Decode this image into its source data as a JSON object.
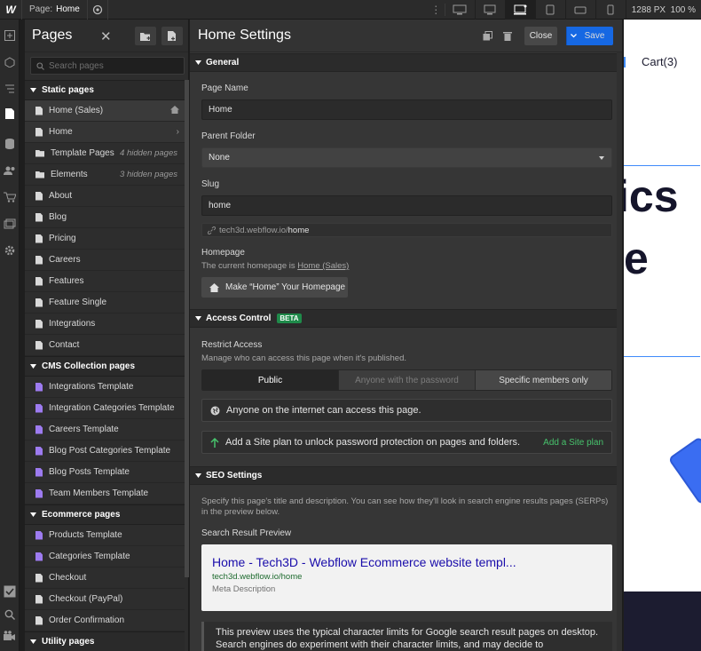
{
  "topbar": {
    "logo": "W",
    "page_label": "Page:",
    "page_name": "Home",
    "size_px": "1288",
    "size_unit": "PX",
    "zoom": "100 %"
  },
  "pages_panel": {
    "title": "Pages",
    "close_glyph": "✕",
    "search_placeholder": "Search pages",
    "sections": {
      "static": "Static pages",
      "cms": "CMS Collection pages",
      "ecommerce": "Ecommerce pages",
      "utility": "Utility pages"
    },
    "static_items": [
      {
        "label": "Home (Sales)",
        "icon": "file-icon"
      },
      {
        "label": "Home",
        "icon": "file-icon"
      },
      {
        "label": "Template Pages",
        "icon": "folder-icon",
        "hint": "4 hidden pages"
      },
      {
        "label": "Elements",
        "icon": "folder-icon",
        "hint": "3 hidden pages"
      },
      {
        "label": "About",
        "icon": "file-icon"
      },
      {
        "label": "Blog",
        "icon": "file-icon"
      },
      {
        "label": "Pricing",
        "icon": "file-icon"
      },
      {
        "label": "Careers",
        "icon": "file-icon"
      },
      {
        "label": "Features",
        "icon": "file-icon"
      },
      {
        "label": "Feature Single",
        "icon": "file-icon"
      },
      {
        "label": "Integrations",
        "icon": "file-icon"
      },
      {
        "label": "Contact",
        "icon": "file-icon"
      }
    ],
    "cms_items": [
      {
        "label": "Integrations Template"
      },
      {
        "label": "Integration Categories Template"
      },
      {
        "label": "Careers Template"
      },
      {
        "label": "Blog Post Categories Template"
      },
      {
        "label": "Blog Posts Template"
      },
      {
        "label": "Team Members Template"
      }
    ],
    "ecommerce_items": [
      {
        "label": "Products Template",
        "cms": true
      },
      {
        "label": "Categories Template",
        "cms": true
      },
      {
        "label": "Checkout",
        "cms": false
      },
      {
        "label": "Checkout (PayPal)",
        "cms": false
      },
      {
        "label": "Order Confirmation",
        "cms": false
      }
    ]
  },
  "settings": {
    "title": "Home Settings",
    "close_label": "Close",
    "save_label": "Save",
    "general": {
      "header": "General",
      "page_name_label": "Page Name",
      "page_name_value": "Home",
      "parent_folder_label": "Parent Folder",
      "parent_folder_value": "None",
      "slug_label": "Slug",
      "slug_value": "home",
      "url_domain": "tech3d.webflow.io/",
      "url_slug": "home",
      "homepage_label": "Homepage",
      "homepage_text": "The current homepage is",
      "homepage_link": "Home (Sales)",
      "make_home_label": "Make “Home” Your Homepage"
    },
    "access": {
      "header": "Access Control",
      "badge": "BETA",
      "restrict_label": "Restrict Access",
      "restrict_desc": "Manage who can access this page when it's published.",
      "options": [
        "Public",
        "Anyone with the password",
        "Specific members only"
      ],
      "public_notice": "Anyone on the internet can access this page.",
      "upgrade_notice": "Add a Site plan to unlock password protection on pages and folders.",
      "upgrade_link": "Add a Site plan"
    },
    "seo": {
      "header": "SEO Settings",
      "desc": "Specify this page's title and description. You can see how they'll look in search engine results pages (SERPs) in the preview below.",
      "preview_label": "Search Result Preview",
      "preview_title": "Home - Tech3D - Webflow Ecommerce website templ...",
      "preview_url": "tech3d.webflow.io/home",
      "preview_desc": "Meta Description",
      "note": "This preview uses the typical character limits for Google search result pages on desktop. Search engines do experiment with their character limits, and may decide to"
    }
  },
  "canvas": {
    "cart": "Cart(3)",
    "headline_1": "ics",
    "headline_2": "e"
  },
  "colors": {
    "accent": "#1668e3",
    "success": "#47c26c",
    "cms_icon": "#9d7bf0"
  }
}
